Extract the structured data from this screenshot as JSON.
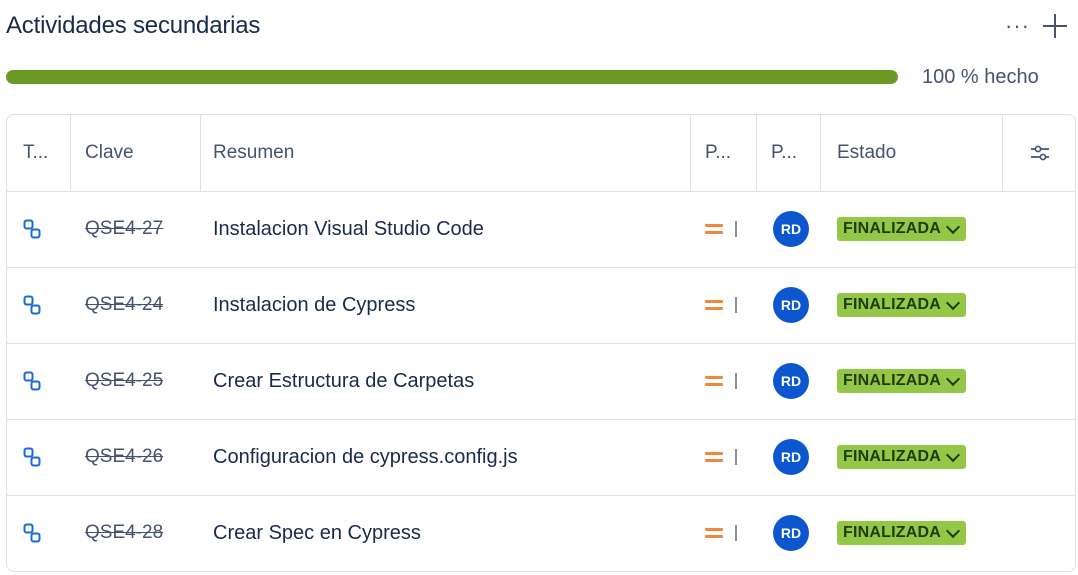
{
  "header": {
    "title": "Actividades secundarias",
    "more_label": "···",
    "add_icon": "plus-icon"
  },
  "progress": {
    "percent": 100,
    "label": "100 % hecho",
    "color": "#6a9a23"
  },
  "table": {
    "columns": [
      "T...",
      "Clave",
      "Resumen",
      "P...",
      "P...",
      "Estado"
    ],
    "config_icon": "column-settings-icon",
    "rows": [
      {
        "type_icon": "subtask-icon",
        "key": "QSE4-27",
        "summary": "Instalacion Visual Studio Code",
        "priority_icon": "priority-medium-icon",
        "assignee": "RD",
        "status": "FINALIZADA"
      },
      {
        "type_icon": "subtask-icon",
        "key": "QSE4-24",
        "summary": "Instalacion de Cypress",
        "priority_icon": "priority-medium-icon",
        "assignee": "RD",
        "status": "FINALIZADA"
      },
      {
        "type_icon": "subtask-icon",
        "key": "QSE4-25",
        "summary": "Crear Estructura de Carpetas",
        "priority_icon": "priority-medium-icon",
        "assignee": "RD",
        "status": "FINALIZADA"
      },
      {
        "type_icon": "subtask-icon",
        "key": "QSE4-26",
        "summary": "Configuracion de cypress.config.js",
        "priority_icon": "priority-medium-icon",
        "assignee": "RD",
        "status": "FINALIZADA"
      },
      {
        "type_icon": "subtask-icon",
        "key": "QSE4-28",
        "summary": "Crear Spec en Cypress",
        "priority_icon": "priority-medium-icon",
        "assignee": "RD",
        "status": "FINALIZADA"
      }
    ]
  },
  "colors": {
    "avatar": "#0c57d0",
    "status_done": "#94c748",
    "priority_medium": "#f0883c",
    "subtask_icon": "#1868db"
  }
}
